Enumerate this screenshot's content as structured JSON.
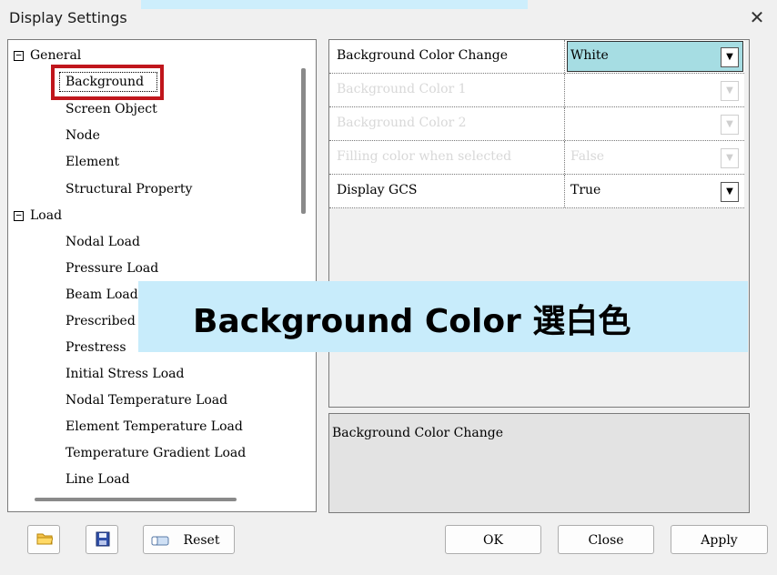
{
  "window": {
    "title": "Display Settings",
    "close_glyph": "✕"
  },
  "tree": {
    "items": [
      {
        "label": "General",
        "expander": "−",
        "level": 0
      },
      {
        "label": "Background",
        "level": 1,
        "selected": true
      },
      {
        "label": "Screen Object",
        "level": 1
      },
      {
        "label": "Node",
        "level": 1
      },
      {
        "label": "Element",
        "level": 1
      },
      {
        "label": "Structural Property",
        "level": 1
      },
      {
        "label": "Load",
        "expander": "−",
        "level": 0
      },
      {
        "label": "Nodal Load",
        "level": 1
      },
      {
        "label": "Pressure Load",
        "level": 1
      },
      {
        "label": "Beam Load",
        "level": 1
      },
      {
        "label": "Prescribed Displacement",
        "level": 1
      },
      {
        "label": "Prestress",
        "level": 1
      },
      {
        "label": "Initial Stress Load",
        "level": 1
      },
      {
        "label": "Nodal Temperature Load",
        "level": 1
      },
      {
        "label": "Element Temperature Load",
        "level": 1
      },
      {
        "label": "Temperature Gradient Load",
        "level": 1
      },
      {
        "label": "Line Load",
        "level": 1
      }
    ]
  },
  "properties": {
    "rows": [
      {
        "name": "Background Color Change",
        "value": "White",
        "enabled": true
      },
      {
        "name": "Background Color 1",
        "value": "",
        "enabled": false
      },
      {
        "name": "Background Color 2",
        "value": "",
        "enabled": false
      },
      {
        "name": "Filling color when selected",
        "value": "False",
        "enabled": false
      },
      {
        "name": "Display GCS",
        "value": "True",
        "enabled": true
      }
    ],
    "dropdown_glyph": "▼",
    "selected_color": "#a6dde3"
  },
  "description": {
    "text": "Background Color Change"
  },
  "overlay": {
    "text": "Background Color  選白色",
    "color": "#c8ecfb"
  },
  "buttons": {
    "open_icon": "folder-open-icon",
    "save_icon": "save-disk-icon",
    "reset": "Reset",
    "ok": "OK",
    "close": "Close",
    "apply": "Apply"
  },
  "accent": {
    "highlight_border": "#c0161c"
  }
}
